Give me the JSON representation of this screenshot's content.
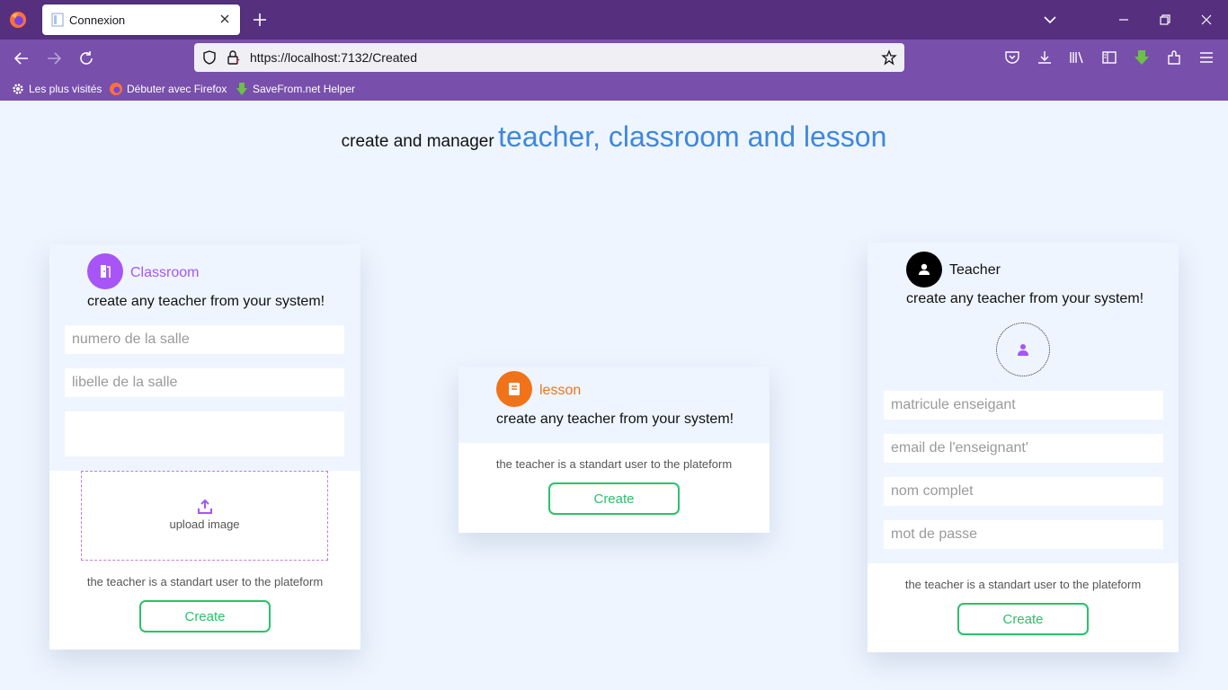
{
  "browser": {
    "tab_title": "Connexion",
    "url": "https://localhost:7132/Created",
    "bookmarks": [
      "Les plus visités",
      "Débuter avec Firefox",
      "SaveFrom.net Helper"
    ]
  },
  "page": {
    "headline_small": "create and manager",
    "headline_big": "teacher, classroom and lesson"
  },
  "classroom": {
    "title": "Classroom",
    "subtitle": "create any teacher from your system!",
    "fields": {
      "numero_placeholder": "numero de la salle",
      "libelle_placeholder": "libelle de la salle"
    },
    "upload_label": "upload image",
    "note": "the teacher is a standart user to the plateform",
    "button": "Create",
    "accent": "#a855f7"
  },
  "lesson": {
    "title": "lesson",
    "subtitle": "create any teacher from your system!",
    "note": "the teacher is a standart user to the plateform",
    "button": "Create",
    "accent": "#f0731a"
  },
  "teacher": {
    "title": "Teacher",
    "subtitle": "create any teacher from your system!",
    "fields": {
      "matricule_placeholder": "matricule enseigant",
      "email_placeholder": "email de l'enseignant'",
      "nom_placeholder": "nom complet",
      "password_placeholder": "mot de passe"
    },
    "note": "the teacher is a standart user to the plateform",
    "button": "Create",
    "accent": "#000000"
  }
}
